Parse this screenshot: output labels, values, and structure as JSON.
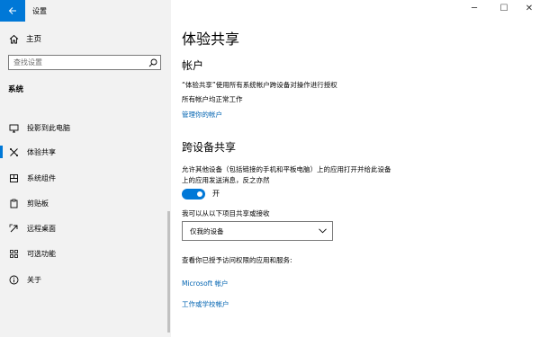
{
  "window": {
    "title": "设置",
    "back_icon": "back-arrow-icon",
    "controls": {
      "minimize": "─",
      "maximize": "☐",
      "close": "✕"
    }
  },
  "sidebar": {
    "home": {
      "label": "主页",
      "icon": "home-icon"
    },
    "search": {
      "placeholder": "查找设置",
      "icon": "search-icon"
    },
    "section_title": "系统",
    "items": [
      {
        "label": "投影到此电脑",
        "icon": "projector-icon",
        "active": false
      },
      {
        "label": "体验共享",
        "icon": "shared-experiences-icon",
        "active": true
      },
      {
        "label": "系统组件",
        "icon": "system-components-icon",
        "active": false
      },
      {
        "label": "剪贴板",
        "icon": "clipboard-icon",
        "active": false
      },
      {
        "label": "远程桌面",
        "icon": "remote-desktop-icon",
        "active": false
      },
      {
        "label": "可选功能",
        "icon": "optional-features-icon",
        "active": false
      },
      {
        "label": "关于",
        "icon": "info-icon",
        "active": false
      }
    ]
  },
  "main": {
    "title": "体验共享",
    "accounts": {
      "heading": "帐户",
      "description": "“体验共享”使用所有系统帐户跨设备对操作进行授权",
      "status": "所有帐户均正常工作",
      "manage_link": "管理你的帐户"
    },
    "cross_device": {
      "heading": "跨设备共享",
      "description_line1": "允许其他设备（包括链接的手机和平板电脑）上的应用打开并给此设备",
      "description_line2": "上的应用发送消息，反之亦然",
      "toggle_state": "开",
      "toggle_on": true,
      "share_label": "我可以从以下项目共享或接收",
      "dropdown_value": "仅我的设备",
      "authorized_label": "查看你已授予访问权限的应用和服务:",
      "link_microsoft": "Microsoft 帐户",
      "link_work": "工作或学校帐户"
    }
  },
  "colors": {
    "accent": "#0078d7",
    "link": "#0063b1",
    "sidebar_bg": "#f2f2f2"
  }
}
